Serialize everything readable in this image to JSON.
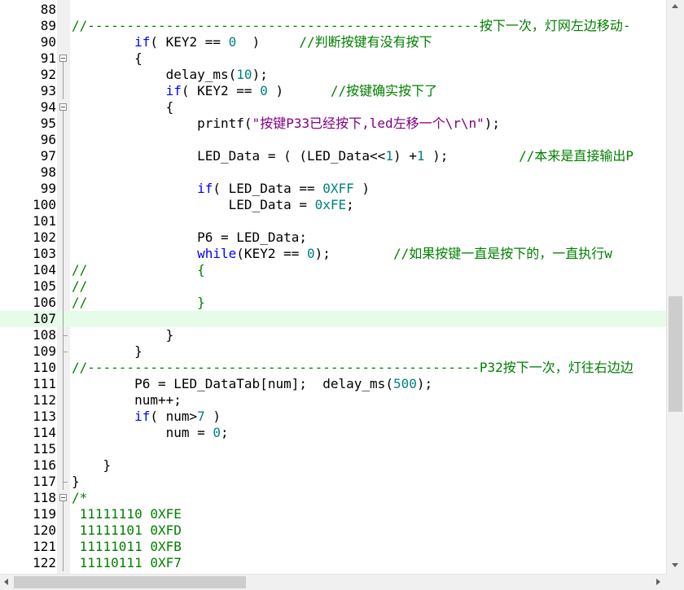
{
  "editor": {
    "lines": [
      {
        "num": "88",
        "text": []
      },
      {
        "num": "89",
        "text": [
          {
            "c": "cm",
            "t": "//--------------------------------------------------按下一次，灯网左边移动-"
          }
        ]
      },
      {
        "num": "90",
        "text": [
          {
            "t": "        "
          },
          {
            "c": "kw",
            "t": "if"
          },
          {
            "t": "( KEY2 == "
          },
          {
            "c": "nm",
            "t": "0"
          },
          {
            "t": "  )     "
          },
          {
            "c": "cm",
            "t": "//判断按键有没有按下"
          }
        ]
      },
      {
        "num": "91",
        "fold": "start",
        "text": [
          {
            "t": "        {"
          }
        ]
      },
      {
        "num": "92",
        "fold": "line",
        "text": [
          {
            "t": "            delay_ms("
          },
          {
            "c": "nm",
            "t": "10"
          },
          {
            "t": ");"
          }
        ]
      },
      {
        "num": "93",
        "fold": "line",
        "text": [
          {
            "t": "            "
          },
          {
            "c": "kw",
            "t": "if"
          },
          {
            "t": "( KEY2 == "
          },
          {
            "c": "nm",
            "t": "0"
          },
          {
            "t": " )      "
          },
          {
            "c": "cm",
            "t": "//按键确实按下了"
          }
        ]
      },
      {
        "num": "94",
        "fold": "start",
        "text": [
          {
            "t": "            {"
          }
        ]
      },
      {
        "num": "95",
        "fold": "line",
        "text": [
          {
            "t": "                printf("
          },
          {
            "c": "st",
            "t": "\"按键P33已经按下,led左移一个\\r\\n\""
          },
          {
            "t": ");"
          }
        ]
      },
      {
        "num": "96",
        "fold": "line",
        "text": []
      },
      {
        "num": "97",
        "fold": "line",
        "text": [
          {
            "t": "                LED_Data = ( (LED_Data<<"
          },
          {
            "c": "nm",
            "t": "1"
          },
          {
            "t": ") +"
          },
          {
            "c": "nm",
            "t": "1"
          },
          {
            "t": " );         "
          },
          {
            "c": "cm",
            "t": "//本来是直接输出P"
          }
        ]
      },
      {
        "num": "98",
        "fold": "line",
        "text": []
      },
      {
        "num": "99",
        "fold": "line",
        "text": [
          {
            "t": "                "
          },
          {
            "c": "kw",
            "t": "if"
          },
          {
            "t": "( LED_Data == "
          },
          {
            "c": "nm",
            "t": "0XFF"
          },
          {
            "t": " )"
          }
        ]
      },
      {
        "num": "100",
        "fold": "line",
        "text": [
          {
            "t": "                    LED_Data = "
          },
          {
            "c": "nm",
            "t": "0xFE"
          },
          {
            "t": ";"
          }
        ]
      },
      {
        "num": "101",
        "fold": "line",
        "text": []
      },
      {
        "num": "102",
        "fold": "line",
        "text": [
          {
            "t": "                P6 = LED_Data;"
          }
        ]
      },
      {
        "num": "103",
        "fold": "line",
        "text": [
          {
            "t": "                "
          },
          {
            "c": "kw",
            "t": "while"
          },
          {
            "t": "(KEY2 == "
          },
          {
            "c": "nm",
            "t": "0"
          },
          {
            "t": ");        "
          },
          {
            "c": "cm",
            "t": "//如果按键一直是按下的，一直执行w"
          }
        ]
      },
      {
        "num": "104",
        "fold": "line",
        "text": [
          {
            "c": "cm",
            "t": "//              {"
          }
        ]
      },
      {
        "num": "105",
        "fold": "line",
        "text": [
          {
            "c": "cm",
            "t": "//"
          }
        ]
      },
      {
        "num": "106",
        "fold": "line",
        "text": [
          {
            "c": "cm",
            "t": "//              }"
          }
        ]
      },
      {
        "num": "107",
        "fold": "line",
        "hl": true,
        "text": []
      },
      {
        "num": "108",
        "fold": "end",
        "text": [
          {
            "t": "            }"
          }
        ]
      },
      {
        "num": "109",
        "fold": "end",
        "text": [
          {
            "t": "        }"
          }
        ]
      },
      {
        "num": "110",
        "fold": "line",
        "text": [
          {
            "c": "cm",
            "t": "//--------------------------------------------------P32按下一次，灯往右边边"
          }
        ]
      },
      {
        "num": "111",
        "fold": "line",
        "text": [
          {
            "t": "        P6 = LED_DataTab[num];  delay_ms("
          },
          {
            "c": "nm",
            "t": "500"
          },
          {
            "t": ");"
          }
        ]
      },
      {
        "num": "112",
        "fold": "line",
        "text": [
          {
            "t": "        num++;"
          }
        ]
      },
      {
        "num": "113",
        "fold": "line",
        "text": [
          {
            "t": "        "
          },
          {
            "c": "kw",
            "t": "if"
          },
          {
            "t": "( num>"
          },
          {
            "c": "nm",
            "t": "7"
          },
          {
            "t": " )"
          }
        ]
      },
      {
        "num": "114",
        "fold": "line",
        "text": [
          {
            "t": "            num = "
          },
          {
            "c": "nm",
            "t": "0"
          },
          {
            "t": ";"
          }
        ]
      },
      {
        "num": "115",
        "fold": "line",
        "text": []
      },
      {
        "num": "116",
        "fold": "line",
        "text": [
          {
            "t": "    }"
          }
        ]
      },
      {
        "num": "117",
        "fold": "end",
        "text": [
          {
            "t": "}"
          }
        ]
      },
      {
        "num": "118",
        "fold": "start",
        "text": [
          {
            "c": "cm",
            "t": "/*"
          }
        ]
      },
      {
        "num": "119",
        "fold": "line",
        "text": [
          {
            "c": "cm",
            "t": " 11111110 0XFE"
          }
        ]
      },
      {
        "num": "120",
        "fold": "line",
        "text": [
          {
            "c": "cm",
            "t": " 11111101 0XFD"
          }
        ]
      },
      {
        "num": "121",
        "fold": "line",
        "text": [
          {
            "c": "cm",
            "t": " 11111011 0XFB"
          }
        ]
      },
      {
        "num": "122",
        "fold": "line",
        "text": [
          {
            "c": "cm",
            "t": " 11110111 0XF7"
          }
        ]
      }
    ]
  },
  "icons": {
    "fold_toggle": "minus-box-icon",
    "scroll_up": "arrow-up-icon",
    "scroll_down": "arrow-down-icon",
    "scroll_left": "arrow-left-icon",
    "scroll_right": "arrow-right-icon"
  }
}
